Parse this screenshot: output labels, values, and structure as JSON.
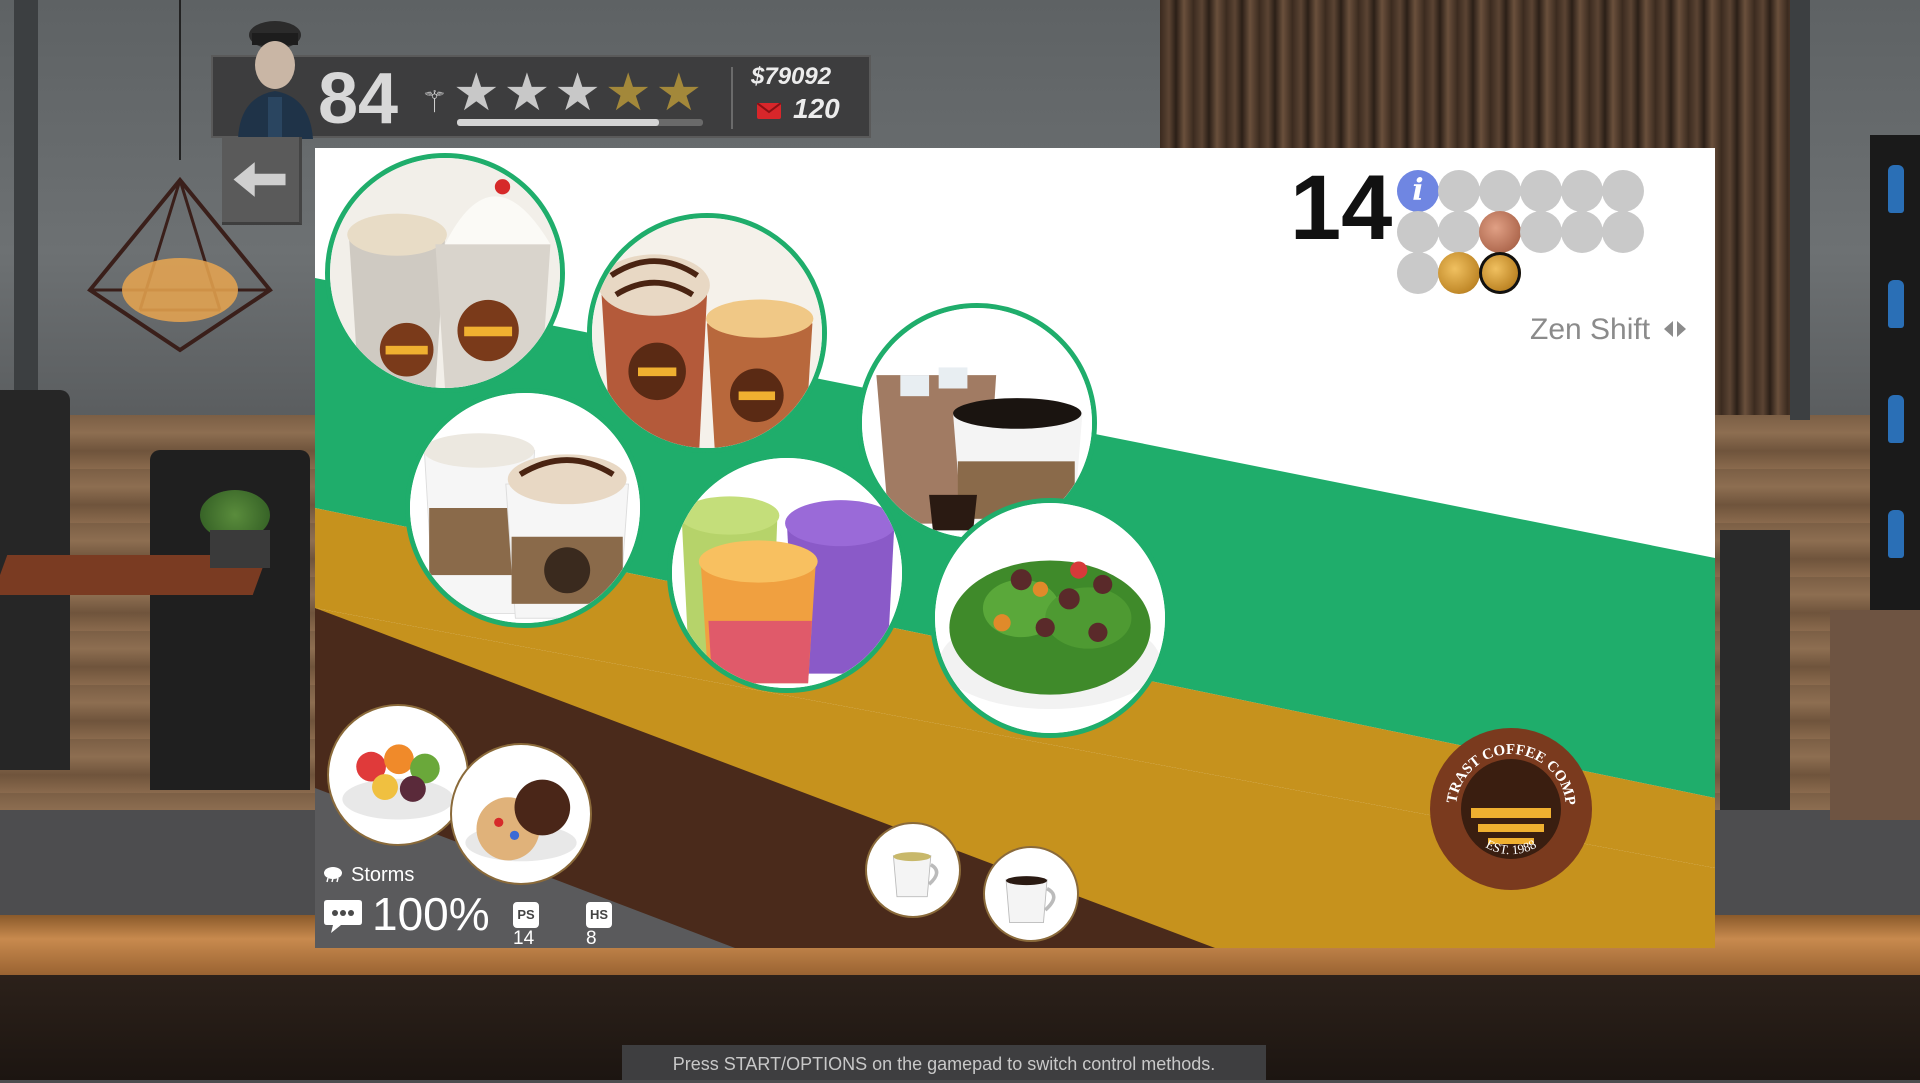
{
  "hud": {
    "level": "84",
    "stars_total": 5,
    "stars_filled_silver": 3,
    "money": "$79092",
    "mail_count": "120",
    "xp_progress": 0.82
  },
  "menu": {
    "day_number": "14",
    "mode_label": "Zen Shift",
    "brand": {
      "top": "CONTRAST COFFEE COMPANY",
      "bottom": "EST. 1988"
    },
    "day_dots": [
      "info",
      "empty",
      "empty",
      "empty",
      "empty",
      "empty",
      "empty",
      "empty",
      "bronze",
      "empty",
      "empty",
      "empty",
      "empty",
      "gold",
      "gold-selected"
    ]
  },
  "status": {
    "weather": "Storms",
    "rating": "100%",
    "ps_label": "PS",
    "ps_value": "14",
    "hs_label": "HS",
    "hs_value": "8"
  },
  "footer": {
    "hint": "Press START/OPTIONS on the gamepad to switch control methods."
  },
  "colors": {
    "green": "#1fad6b",
    "mustard": "#c6921d",
    "brown": "#4a2a1b",
    "accent_info": "#6f86e2"
  }
}
